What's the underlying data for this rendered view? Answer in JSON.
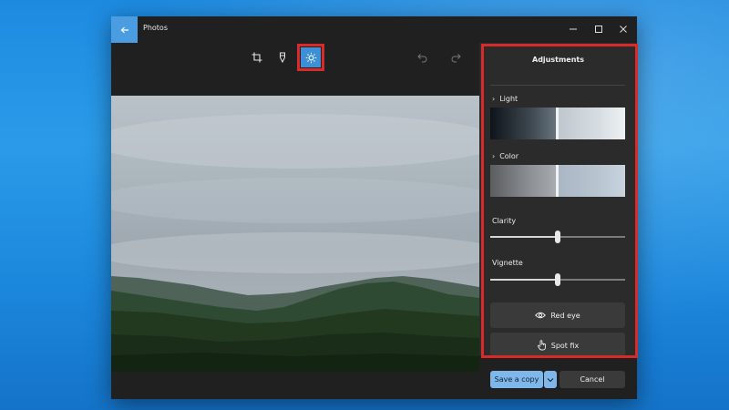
{
  "app": {
    "title": "Photos"
  },
  "toolbar": {
    "crop_icon": "crop-icon",
    "markup_icon": "markup-icon",
    "adjust_icon": "brightness-icon",
    "undo_icon": "undo-icon",
    "redo_icon": "redo-icon",
    "active_tool": "adjust"
  },
  "panel": {
    "title": "Adjustments",
    "light_label": "Light",
    "color_label": "Color",
    "clarity_label": "Clarity",
    "clarity_value": 0.5,
    "vignette_label": "Vignette",
    "vignette_value": 0.5,
    "red_eye_label": "Red eye",
    "spot_fix_label": "Spot fix"
  },
  "footer": {
    "save_label": "Save a copy",
    "cancel_label": "Cancel"
  },
  "colors": {
    "accent": "#4a9de0",
    "highlight": "#d92a2a",
    "panel_bg": "#2b2b2b",
    "window_bg": "#202020"
  }
}
